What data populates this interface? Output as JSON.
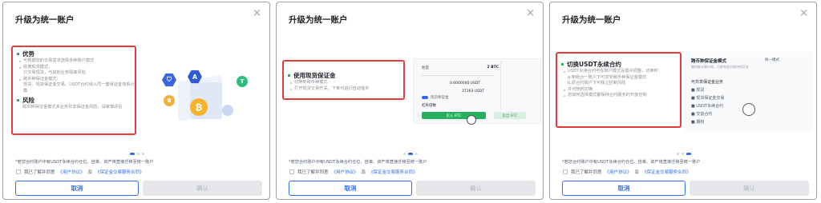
{
  "panels": [
    {
      "title": "升级为统一账户",
      "sections": [
        {
          "heading": "优势",
          "items": [
            "可根据您的交易需求选择多种账户模式",
            "经典现货模式：",
            "跨币种保证金模式：",
            "现货、现货保证金交易、USDT合约纳入同一套保证金体系计算"
          ],
          "subs": [
            "只交易现货，与其他业务隔离风险"
          ]
        },
        {
          "heading": "风险",
          "items": [
            "跨币种保证金模式多业务共享保证金风险，请审慎评估"
          ],
          "subs": []
        }
      ],
      "illustration": {
        "coin1": "B",
        "coin2": "A",
        "coin3": "T",
        "coin4": "₿"
      }
    },
    {
      "title": "升级为统一账户",
      "heading": "使用现货保证金",
      "items": [
        "切换到跨币种模式",
        "打开现货交易开关，下单可进行自动借币"
      ],
      "mock": {
        "row1_label": "数量",
        "row1_value": "2 BTC",
        "row2_value": "0.0000000 USDT",
        "row3_value": "37163 USDT",
        "toggle_label": "现货保证金",
        "select_label": "杠杆倍数",
        "buy_label": "买入 BTC",
        "sell_label": "卖出 BTC"
      }
    },
    {
      "title": "升级为统一账户",
      "heading": "切换USDT永续合约",
      "items": [
        "USDT永续合约可在账户模式设置中调整，切换时：",
        "a.新组合一账户下可享受跨币种保证金模式",
        "b.原合约账户下可独立控制风险",
        "并可随时切换",
        "您如何选择模式都保持合约服务的开放控制"
      ],
      "mock": {
        "title": "跨币种保证金模式",
        "subtitle": "最初能计算价格，可能有部分维持保证金",
        "side": "统一模式",
        "section": "可共享保证金业务",
        "opt1": "现货",
        "opt2": "现货保证金交易",
        "opt3": "USDT永续合约",
        "opt4": "交割合约",
        "opt5": "期权"
      }
    }
  ],
  "common": {
    "close_icon": "×",
    "note": "*若您合约账户中有USDT永续合约仓位、挂单、资产将直接迁移至统一账户",
    "agree_prefix": "我已了解并同意",
    "link1": "《用户协议》",
    "and": "及",
    "link2": "《保证金交易服务合同》",
    "cancel_label": "取消",
    "confirm_label": "确认"
  },
  "colors": {
    "accent": "#2f6bf0",
    "green": "#27b05b",
    "red": "#e83b3b"
  }
}
